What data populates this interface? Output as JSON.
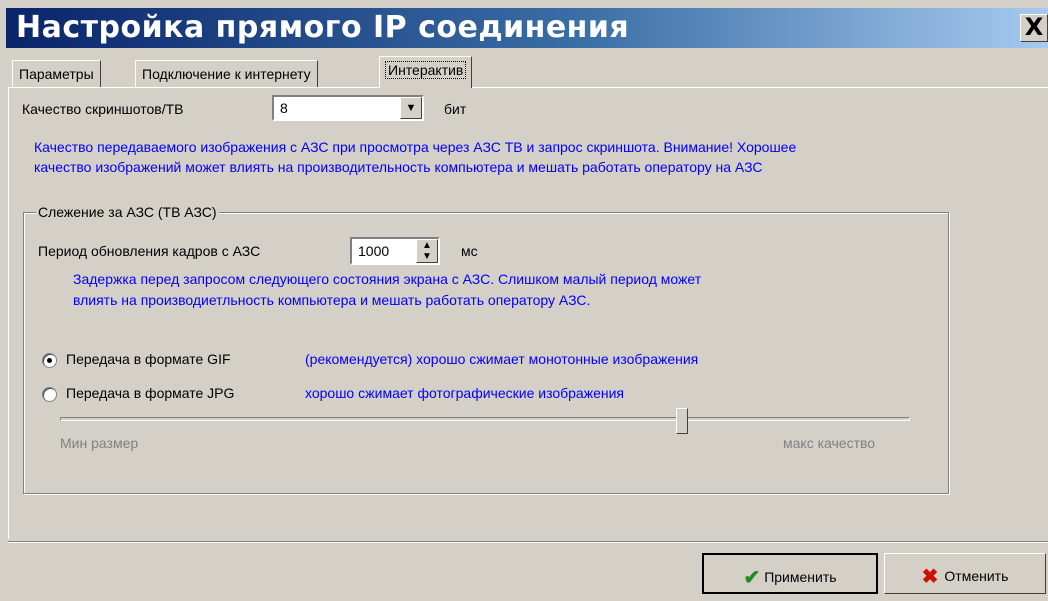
{
  "window": {
    "title": "Настройка прямого IP соединения",
    "close_glyph": "X"
  },
  "tabs": [
    {
      "label": "Параметры",
      "active": false
    },
    {
      "label": "Подключение к интернету",
      "active": false
    },
    {
      "label": "Интерактив",
      "active": true
    }
  ],
  "screenshot_quality": {
    "label": "Качество скриншотов/ТВ",
    "value": "8",
    "unit": "бит",
    "description_line1": "Качество передаваемого изображения с АЗС при просмотра через АЗС ТВ и запрос скриншота. Внимание! Хорошее",
    "description_line2": "качество изображений может влиять на производительность компьютера и мешать работать оператору на АЗС"
  },
  "monitoring": {
    "group_title": "Слежение за АЗС (ТВ АЗС)",
    "period_label": "Период обновления кадров с АЗС",
    "period_value": "1000",
    "period_unit": "мс",
    "period_desc_line1": "Задержка перед запросом следующего состояния экрана с АЗС. Слишком малый период может",
    "period_desc_line2": "влиять на производиетльность компьютера и мешать работать оператору АЗС.",
    "gif_label": "Передача в формате GIF",
    "gif_desc": "(рекомендуется) хорошо сжимает монотонные изображения",
    "jpg_label": "Передача в формате JPG",
    "jpg_desc": "хорошо сжимает фотографические изображения",
    "selected_format": "GIF",
    "slider_min_label": "Мин размер",
    "slider_max_label": "макс качество",
    "slider_level": 0.74
  },
  "buttons": {
    "apply": "Применить",
    "cancel": "Отменить"
  },
  "icons": {
    "apply": "check-icon",
    "cancel": "cross-icon",
    "combo": "chevron-down-icon",
    "spin": "spin-arrows-icon"
  },
  "colors": {
    "title_gradient_start": "#0a246a",
    "title_gradient_end": "#a6caf0",
    "hint_text": "#0000ff",
    "disabled_text": "#808080",
    "apply_icon": "#228b22",
    "cancel_icon": "#cc1100"
  }
}
